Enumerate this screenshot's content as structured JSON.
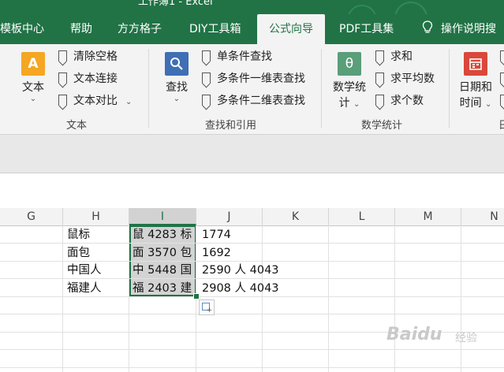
{
  "window": {
    "title": "工作簿1 - Excel"
  },
  "tabs": [
    {
      "label": "模板中心"
    },
    {
      "label": "帮助"
    },
    {
      "label": "方方格子"
    },
    {
      "label": "DIY工具箱"
    },
    {
      "label": "公式向导"
    },
    {
      "label": "PDF工具集"
    },
    {
      "label": "操作说明搜"
    }
  ],
  "active_tab": "公式向导",
  "ribbon": {
    "text_group": {
      "label": "文本",
      "big_button": "文本",
      "items": [
        "清除空格",
        "文本连接",
        "文本对比"
      ]
    },
    "lookup_group": {
      "label": "查找和引用",
      "big_button": "查找",
      "items": [
        "单条件查找",
        "多条件一维表查找",
        "多条件二维表查找"
      ]
    },
    "math_group": {
      "label": "数学统计",
      "big_button_line1": "数学统",
      "big_button_line2": "计",
      "big_icon": "θ",
      "items": [
        "求和",
        "求平均数",
        "求个数"
      ]
    },
    "date_group": {
      "big_button_line1": "日期和",
      "big_button_line2": "时间",
      "label_partial": "日"
    }
  },
  "columns": [
    "G",
    "H",
    "I",
    "J",
    "K",
    "L",
    "M",
    "N"
  ],
  "selected_column": "I",
  "cells": {
    "H": [
      "鼠标",
      "面包",
      "中国人",
      "福建人"
    ],
    "I": [
      "鼠 4283 标",
      "面 3570 包",
      "中 5448 国",
      "福 2403 建"
    ],
    "J": [
      "1774",
      "1692",
      "2590 人 4043",
      "2908 人 4043"
    ]
  },
  "watermark": {
    "brand": "Baidu",
    "suffix": "经验"
  },
  "colors": {
    "accent": "#217346",
    "selection_fill": "#d3d3d3",
    "ribbon_bg": "#f3f3f3"
  }
}
